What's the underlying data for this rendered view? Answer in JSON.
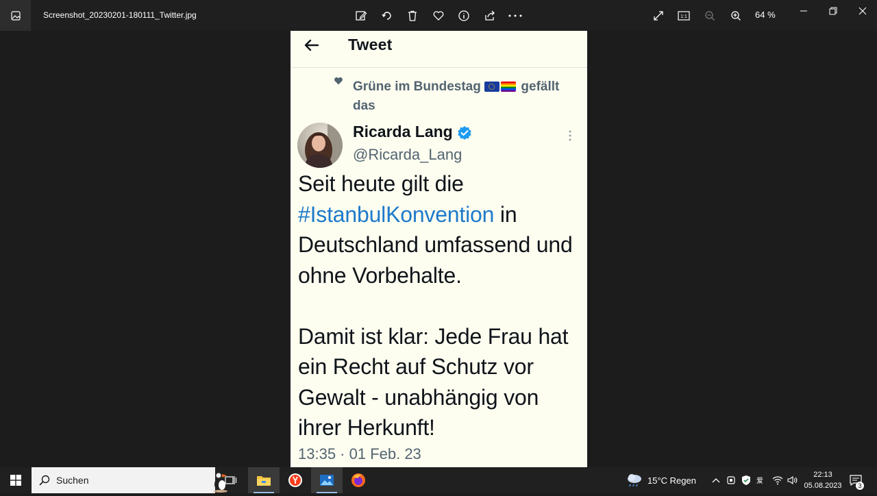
{
  "window": {
    "file_name": "Screenshot_20230201-180111_Twitter.jpg",
    "zoom_level": "64 %"
  },
  "tweet": {
    "header_title": "Tweet",
    "liked_by": "Grüne im Bundestag",
    "liked_suffix": "gefällt das",
    "author_name": "Ricarda Lang",
    "author_handle": "@Ricarda_Lang",
    "text_line1_prefix": "Seit heute gilt die",
    "hashtag": "#IstanbulKonvention",
    "text_line1_suffix": "in Deutschland umfassend und ohne Vorbehalte.",
    "text_para2": "Damit ist klar: Jede Frau hat ein Recht auf Schutz vor Gewalt - unabhängig von ihrer Herkunft!",
    "timestamp": "13:35 · 01 Feb. 23"
  },
  "taskbar": {
    "search_placeholder": "Suchen",
    "weather": "15°C  Regen",
    "time": "22:13",
    "date": "05.08.2023",
    "notification_count": "3"
  },
  "colors": {
    "hashtag": "#1d7acb",
    "verified": "#1d9bf0",
    "tweet_bg": "#fdfdf0"
  }
}
